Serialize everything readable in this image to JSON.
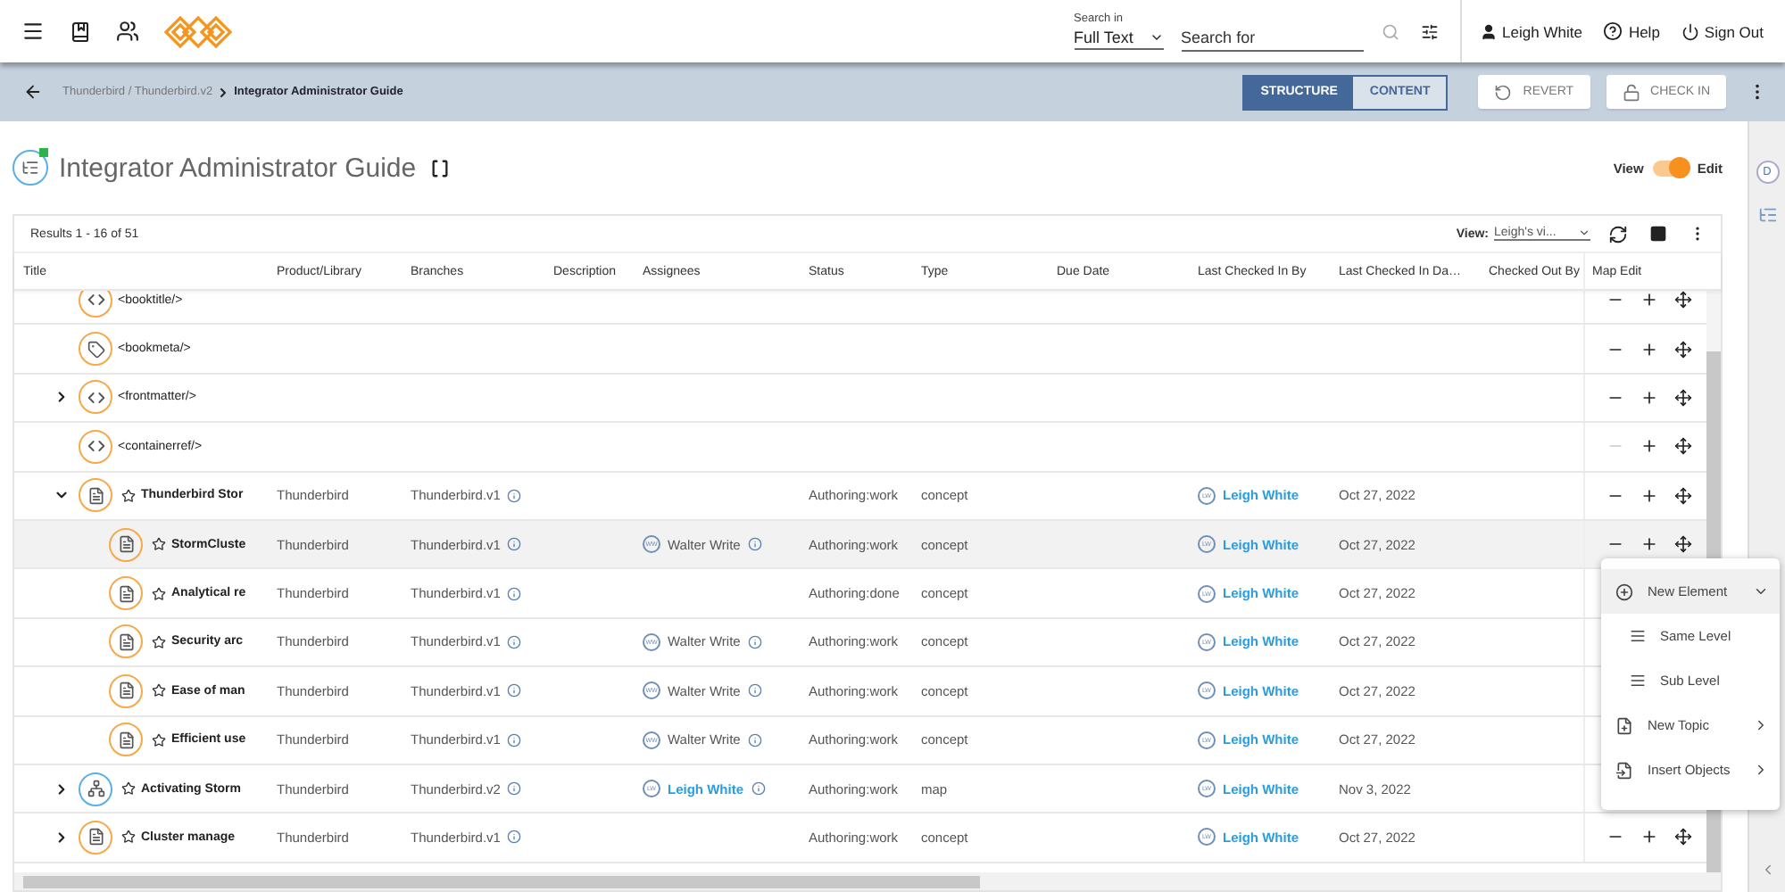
{
  "top_bar": {
    "search_in_label": "Search in",
    "search_scope": "Full Text",
    "search_placeholder": "Search for",
    "user": "Leigh White",
    "help": "Help",
    "sign_out": "Sign Out"
  },
  "toolbar": {
    "breadcrumb": "Thunderbird / Thunderbird.v2",
    "current": "Integrator Administrator Guide",
    "view_tabs": [
      {
        "label": "STRUCTURE",
        "selected": true
      },
      {
        "label": "CONTENT",
        "selected": false
      }
    ],
    "buttons": [
      {
        "kind": "revert",
        "label": "REVERT"
      },
      {
        "kind": "checkin",
        "label": "CHECK IN"
      }
    ]
  },
  "page": {
    "title": "Integrator Administrator Guide",
    "mode": {
      "left": "View",
      "right": "Edit",
      "on": true
    }
  },
  "table": {
    "results": "Results 1 - 16 of 51",
    "view_label": "View:",
    "view_value": "Leigh's vi...",
    "columns": [
      "Title",
      "Product/Library",
      "Branches",
      "Description",
      "Assignees",
      "Status",
      "Type",
      "Due Date",
      "Last Checked In By",
      "Last Checked In Da…",
      "Checked Out By",
      "Map Edit"
    ],
    "rows": [
      {
        "kind": "code",
        "title": "<booktitle/>",
        "selected": false,
        "remove_disabled": false
      },
      {
        "kind": "tag",
        "title": "<bookmeta/>",
        "selected": false,
        "remove_disabled": false
      },
      {
        "kind": "code",
        "title": "<frontmatter/>",
        "expanded": false,
        "selected": false,
        "remove_disabled": false
      },
      {
        "kind": "code",
        "title": "<containerref/>",
        "selected": false,
        "remove_disabled": true
      },
      {
        "kind": "topic",
        "title": "Thunderbird Stor",
        "expanded": true,
        "selected": false,
        "remove_disabled": false,
        "product": "Thunderbird",
        "branch": "Thunderbird.v1",
        "status": "Authoring:work",
        "type": "concept",
        "last_checked_by": {
          "initials": "LW",
          "name": "Leigh White"
        },
        "last_checked_date": "Oct 27, 2022",
        "children": [
          {
            "kind": "topic",
            "title": "StormCluste",
            "selected": true,
            "remove_disabled": false,
            "product": "Thunderbird",
            "branch": "Thunderbird.v1",
            "assignee": {
              "initials": "WW",
              "name": "Walter Write",
              "link": false
            },
            "status": "Authoring:work",
            "type": "concept",
            "last_checked_by": {
              "initials": "LW",
              "name": "Leigh White"
            },
            "last_checked_date": "Oct 27, 2022"
          },
          {
            "kind": "topic",
            "title": "Analytical re",
            "selected": false,
            "product": "Thunderbird",
            "branch": "Thunderbird.v1",
            "status": "Authoring:done",
            "type": "concept",
            "last_checked_by": {
              "initials": "LW",
              "name": "Leigh White"
            },
            "last_checked_date": "Oct 27, 2022"
          },
          {
            "kind": "topic",
            "title": "Security arc",
            "selected": false,
            "product": "Thunderbird",
            "branch": "Thunderbird.v1",
            "assignee": {
              "initials": "WW",
              "name": "Walter Write",
              "link": false
            },
            "status": "Authoring:work",
            "type": "concept",
            "last_checked_by": {
              "initials": "LW",
              "name": "Leigh White"
            },
            "last_checked_date": "Oct 27, 2022"
          },
          {
            "kind": "topic",
            "title": "Ease of man",
            "selected": false,
            "product": "Thunderbird",
            "branch": "Thunderbird.v1",
            "assignee": {
              "initials": "WW",
              "name": "Walter Write",
              "link": false
            },
            "status": "Authoring:work",
            "type": "concept",
            "last_checked_by": {
              "initials": "LW",
              "name": "Leigh White"
            },
            "last_checked_date": "Oct 27, 2022"
          },
          {
            "kind": "topic",
            "title": "Efficient use",
            "selected": false,
            "product": "Thunderbird",
            "branch": "Thunderbird.v1",
            "assignee": {
              "initials": "WW",
              "name": "Walter Write",
              "link": false
            },
            "status": "Authoring:work",
            "type": "concept",
            "last_checked_by": {
              "initials": "LW",
              "name": "Leigh White"
            },
            "last_checked_date": "Oct 27, 2022"
          }
        ]
      },
      {
        "kind": "map",
        "title": "Activating Storm",
        "expanded": false,
        "selected": false,
        "product": "Thunderbird",
        "branch": "Thunderbird.v2",
        "assignee": {
          "initials": "LW",
          "name": "Leigh White",
          "link": true
        },
        "status": "Authoring:work",
        "type": "map",
        "last_checked_by": {
          "initials": "LW",
          "name": "Leigh White"
        },
        "last_checked_date": "Nov 3, 2022"
      },
      {
        "kind": "topic",
        "title": "Cluster manage",
        "expanded": false,
        "selected": false,
        "remove_disabled": false,
        "product": "Thunderbird",
        "branch": "Thunderbird.v1",
        "status": "Authoring:work",
        "type": "concept",
        "last_checked_by": {
          "initials": "LW",
          "name": "Leigh White"
        },
        "last_checked_date": "Oct 27, 2022"
      }
    ]
  },
  "context_menu": {
    "items": [
      {
        "kind": "group",
        "label": "New Element",
        "highlighted": true
      },
      {
        "kind": "same",
        "label": "Same Level",
        "highlighted": false
      },
      {
        "kind": "sub",
        "label": "Sub Level",
        "highlighted": false
      },
      {
        "kind": "topic",
        "label": "New Topic",
        "highlighted": false
      },
      {
        "kind": "insert",
        "label": "Insert Objects",
        "highlighted": false
      }
    ]
  },
  "right_rail": {
    "avatar": "D"
  }
}
